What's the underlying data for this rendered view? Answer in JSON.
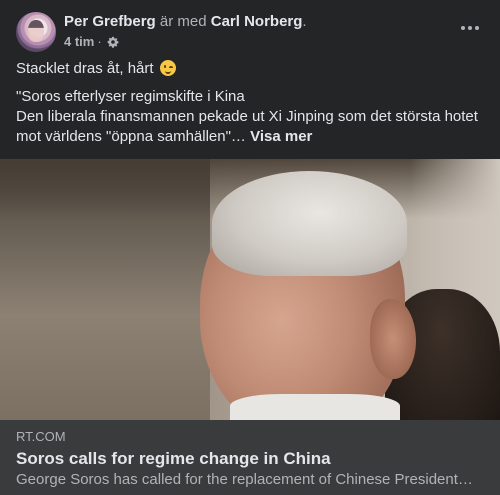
{
  "post": {
    "author": "Per Grefberg",
    "with_text": "är med",
    "tagged_user": "Carl Norberg",
    "tagged_suffix": ".",
    "time": "4 tim",
    "time_separator": "·",
    "audience_icon": "gear-icon",
    "more_icon": "more-options-icon",
    "text_line": "Stacklet dras åt, hårt",
    "emoji": "winking-face-emoji",
    "quote_lines": [
      "\"Soros efterlyser regimskifte i Kina",
      "Den liberala finansmannen pekade ut Xi Jinping som det största hotet",
      "mot världens \"öppna samhällen\"…"
    ],
    "see_more_label": "Visa mer"
  },
  "link_preview": {
    "image": "portrait-photo",
    "domain": "RT.COM",
    "title": "Soros calls for regime change in China",
    "description": "George Soros has called for the replacement of Chinese President…"
  },
  "colors": {
    "background": "#242526",
    "primary_text": "#e4e6eb",
    "secondary_text": "#b0b3b8",
    "link_card": "#3a3b3c"
  }
}
